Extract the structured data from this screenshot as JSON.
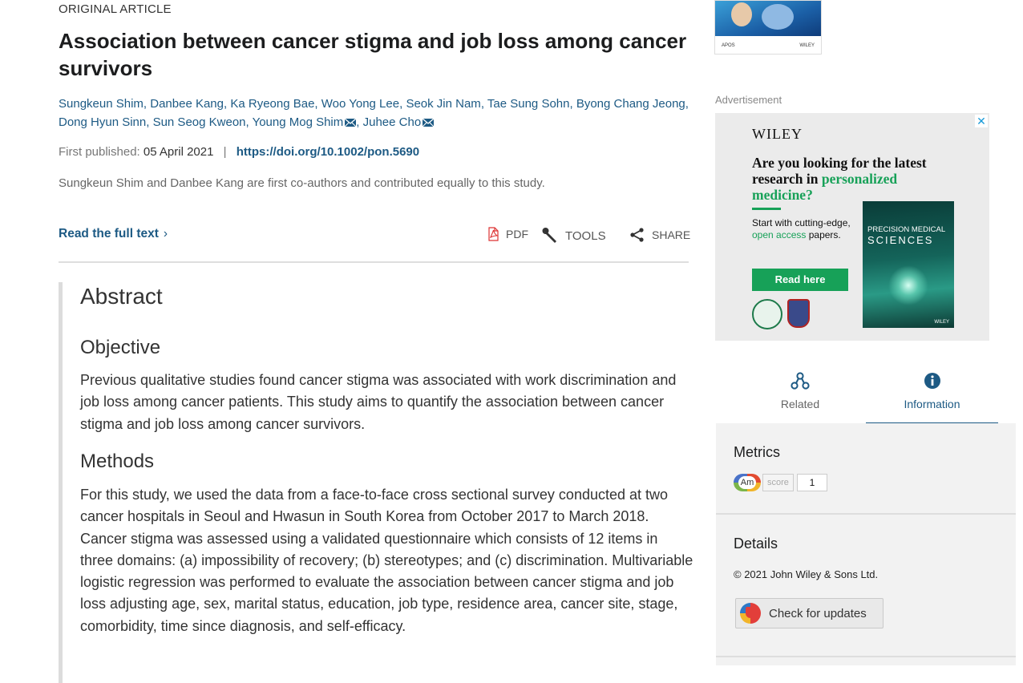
{
  "article": {
    "type": "ORIGINAL ARTICLE",
    "title": "Association between cancer stigma and job loss among cancer survivors",
    "authors": [
      {
        "name": "Sungkeun Shim",
        "sep": ", "
      },
      {
        "name": "Danbee Kang",
        "sep": ", "
      },
      {
        "name": "Ka Ryeong Bae",
        "sep": ", "
      },
      {
        "name": "Woo Yong Lee",
        "sep": ", "
      },
      {
        "name": "Seok Jin Nam",
        "sep": ", "
      },
      {
        "name": "Tae Sung Sohn",
        "sep": ", "
      },
      {
        "name": "Byong Chang Jeong",
        "sep": ", "
      },
      {
        "name": "Dong Hyun Sinn",
        "sep": ", "
      },
      {
        "name": "Sun Seog Kweon",
        "sep": ", "
      },
      {
        "name": "Young Mog Shim",
        "sep": ", "
      },
      {
        "name": "Juhee Cho",
        "sep": ""
      }
    ],
    "published_label": "First published:",
    "published_date": "05 April 2021",
    "divider": "|",
    "doi": "https://doi.org/10.1002/pon.5690",
    "note": "Sungkeun Shim and Danbee Kang are first co-authors and contributed equally to this study.",
    "read_full_text": "Read the full text",
    "read_chevron": "›",
    "actions": {
      "pdf": "PDF",
      "tools": "TOOLS",
      "share": "SHARE"
    }
  },
  "abstract": {
    "heading": "Abstract",
    "objective_heading": "Objective",
    "objective_text": "Previous qualitative studies found cancer stigma was associated with work discrimination and job loss among cancer patients. This study aims to quantify the association between cancer stigma and job loss among cancer survivors.",
    "methods_heading": "Methods",
    "methods_text": "For this study, we used the data from a face-to-face cross sectional survey conducted at two cancer hospitals in Seoul and Hwasun in South Korea from October 2017 to March 2018. Cancer stigma was assessed using a validated questionnaire which consists of 12 items in three domains: (a) impossibility of recovery; (b) stereotypes; and (c) discrimination. Multivariable logistic regression was performed to evaluate the association between cancer stigma and job loss adjusting age, sex, marital status, education, job type, residence area, cancer site, stage, comorbidity, time since diagnosis, and self-efficacy."
  },
  "cover": {
    "left_text": "APOS",
    "right_text": "WILEY"
  },
  "ad": {
    "label": "Advertisement",
    "close": "✕",
    "brand": "WILEY",
    "headline_a": "Are you looking for the latest research in ",
    "headline_b": "personalized medicine?",
    "body_a": "Start with cutting-edge, ",
    "body_b": "open access",
    "body_c": " papers.",
    "button": "Read here",
    "journal_line1": "PRECISION MEDICAL",
    "journal_line2": "SCIENCES",
    "journal_footer": "WILEY"
  },
  "tabs": {
    "related": "Related",
    "information": "Information"
  },
  "panel": {
    "metrics_title": "Metrics",
    "altmetric_logo": "Am",
    "altmetric_score_label": "score",
    "altmetric_score": "1",
    "details_title": "Details",
    "copyright": "© 2021 John Wiley & Sons Ltd.",
    "check_updates": "Check for updates"
  },
  "colors": {
    "link": "#1d5a84",
    "accent_green": "#17a158",
    "panel_bg": "#f2f2f2"
  },
  "icons": [
    "pdf-icon",
    "wrench-icon",
    "share-icon",
    "mail-icon",
    "related-icon",
    "info-icon",
    "close-icon"
  ]
}
